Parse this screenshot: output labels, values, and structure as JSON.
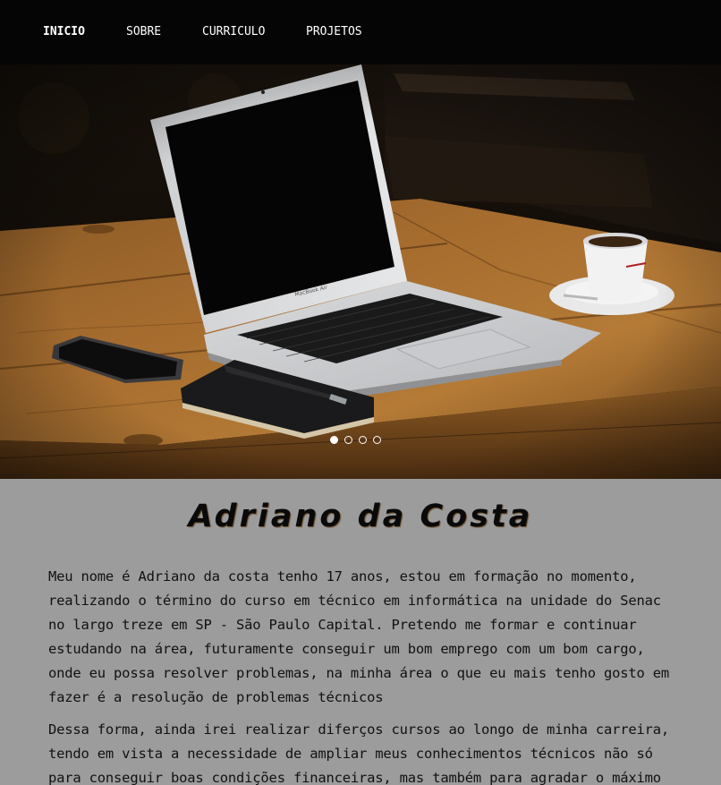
{
  "nav": {
    "items": [
      {
        "label": "INICIO",
        "active": true
      },
      {
        "label": "SOBRE",
        "active": false
      },
      {
        "label": "CURRICULO",
        "active": false
      },
      {
        "label": "PROJETOS",
        "active": false
      }
    ]
  },
  "hero": {
    "image": "laptop-on-wooden-table-photo",
    "slides_total": 4,
    "active_slide": 1
  },
  "profile": {
    "name": "Adriano da Costa",
    "paragraph_1": "Meu nome é Adriano da costa tenho 17 anos, estou em formação no momento, realizando o término do curso em técnico em informática na unidade do Senac no largo treze em SP - São Paulo Capital. Pretendo me formar e continuar estudando na área, futuramente conseguir um bom emprego com um bom cargo, onde eu possa resolver problemas, na minha área o que eu mais tenho gosto em fazer é a resolução de problemas técnicos",
    "paragraph_2": "Dessa forma, ainda irei realizar diferços cursos ao longo de minha carreira, tendo em vista a necessidade de ampliar meus conhecimentos técnicos não só para conseguir boas condições financeiras, mas também para agradar o máximo"
  },
  "colors": {
    "navbar_bg": "#050505",
    "content_bg": "#9c9c9c",
    "text": "#111111"
  }
}
